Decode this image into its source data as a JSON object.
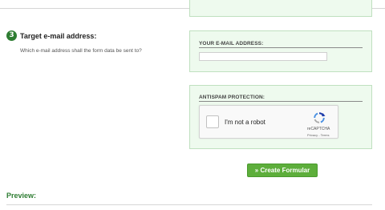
{
  "step": {
    "number": "3",
    "title": "Target e-mail address:",
    "description": "Which e-mail address shall the form data be sent to?"
  },
  "email_panel": {
    "label": "YOUR E-MAIL ADDRESS:",
    "value": ""
  },
  "antispam_panel": {
    "label": "ANTISPAM PROTECTION:",
    "captcha_label": "I'm not a robot",
    "captcha_brand": "reCAPTCHA",
    "captcha_links": "Privacy - Terms"
  },
  "create_button": {
    "label": "» Create Formular"
  },
  "preview": {
    "title": "Preview:"
  },
  "colors": {
    "accent_green": "#2e7d32",
    "button_green": "#5dae3b",
    "panel_bg": "#eefaee"
  },
  "icons": [
    "step-number-icon",
    "recaptcha-logo-icon",
    "checkbox-icon"
  ]
}
